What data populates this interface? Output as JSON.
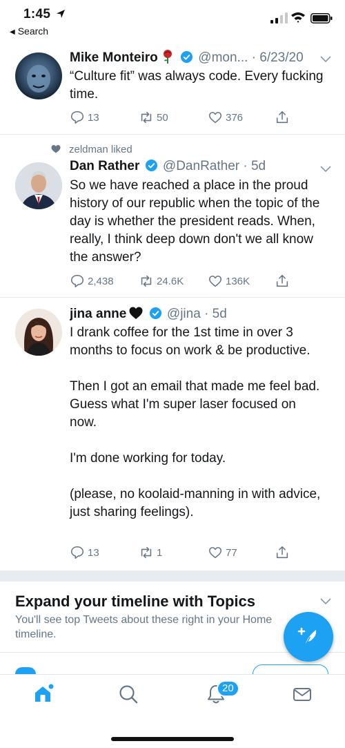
{
  "status_bar": {
    "time": "1:45",
    "back_label": "Search"
  },
  "tweets": [
    {
      "name": "Mike Monteiro",
      "handle_time": "@mon... · 6/23/20",
      "emoji": "rose-icon",
      "verified": true,
      "text": "“Culture fit” was always code. Every fucking time.",
      "replies": "13",
      "retweets": "50",
      "likes": "376"
    },
    {
      "social_context": "zeldman liked",
      "name": "Dan Rather",
      "handle_time": "@DanRather · 5d",
      "verified": true,
      "text": "So we have reached a place in the proud history of our republic when the topic of the day is whether the president reads. When, really, I think deep down don't we all know the answer?",
      "replies": "2,438",
      "retweets": "24.6K",
      "likes": "136K"
    },
    {
      "name": "jina anne",
      "handle_time": "@jina · 5d",
      "emoji": "black-heart-icon",
      "verified": true,
      "text": "I drank coffee for the 1st time in over 3 months to focus on work & be productive.\n\nThen I got an email that made me feel bad. Guess what I'm super laser focused on now.\n\nI'm done working for today.\n\n(please, no koolaid-manning in with advice, just sharing feelings).",
      "replies": "13",
      "retweets": "1",
      "likes": "77"
    }
  ],
  "topics": {
    "title": "Expand your timeline with Topics",
    "subtitle": "You'll see top Tweets about these right in your Home timeline."
  },
  "tabbar": {
    "items": [
      "home-icon",
      "search-icon",
      "notifications-icon",
      "messages-icon"
    ],
    "notification_count": "20"
  },
  "colors": {
    "accent": "#1da1f2",
    "muted": "#657786",
    "text": "#14171a",
    "separator": "#e6ecf0"
  }
}
